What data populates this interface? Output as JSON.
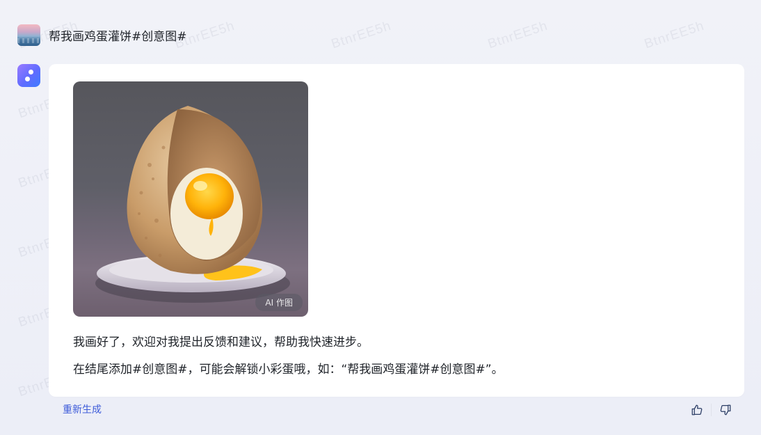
{
  "watermark": {
    "text": "BtnrEE5h"
  },
  "conversation": {
    "user_message": {
      "text": "帮我画鸡蛋灌饼#创意图#"
    },
    "bot_message": {
      "image": {
        "badge": "AI 作图",
        "subject": "egg-pancake-illustration"
      },
      "lines": [
        "我画好了，欢迎对我提出反馈和建议，帮助我快速进步。",
        "在结尾添加#创意图#，可能会解锁小彩蛋哦，如：“帮我画鸡蛋灌饼#创意图#”。"
      ]
    }
  },
  "actions": {
    "regenerate_label": "重新生成",
    "like_icon": "thumbs-up-icon",
    "dislike_icon": "thumbs-down-icon"
  },
  "colors": {
    "accent": "#3d5bd9",
    "page_background": "#eef0f7",
    "card_background": "#ffffff",
    "bot_avatar": "#6f6cff"
  }
}
